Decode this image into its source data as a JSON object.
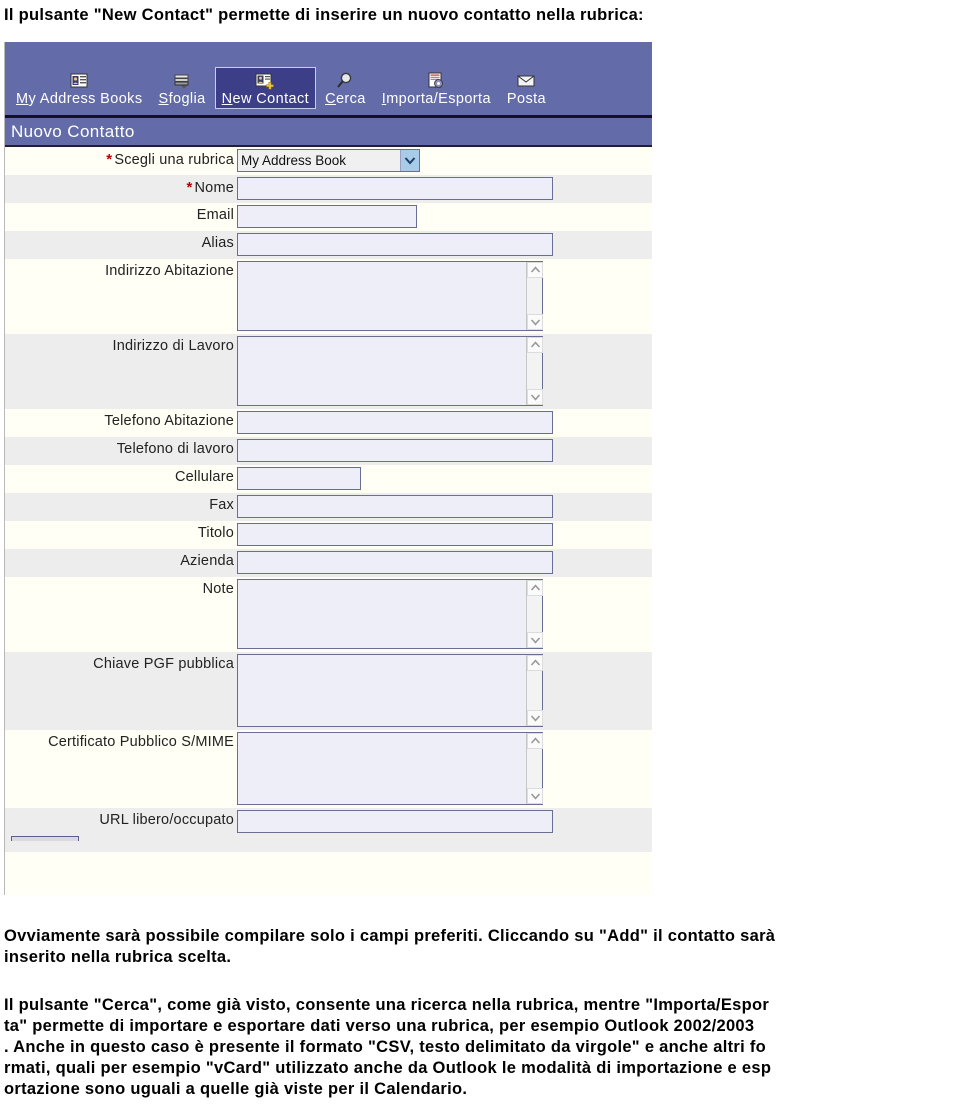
{
  "document": {
    "intro_text": "Il pulsante \"New Contact\" permette di inserire un nuovo contatto nella rubrica:",
    "para_1_line_1": "Ovviamente sarà possibile compilare solo i campi preferiti. Cliccando su \"Add\" il contatto sarà",
    "para_1_line_2": "inserito nella rubrica scelta.",
    "para_2_line_1": "Il pulsante \"Cerca\", come già visto, consente una ricerca nella rubrica, mentre \"Importa/Espor",
    "para_2_line_2": "ta\" permette di importare e esportare dati verso una rubrica, per esempio Outlook 2002/2003",
    "para_2_line_3": ". Anche in questo caso è presente il formato \"CSV, testo delimitato da virgole\" e anche altri fo",
    "para_2_line_4": "rmati, quali per esempio \"vCard\" utilizzato anche da Outlook le modalità di importazione e esp",
    "para_2_line_5": "ortazione sono uguali a quelle già viste per il Calendario."
  },
  "colors": {
    "toolbar_bg": "#636ca8",
    "toolbar_selected_bg": "#3c3f87",
    "form_header_bg": "#636ca8",
    "row_alt_bg": "#ededed",
    "row_bg": "#fffff5",
    "input_bg": "#eeeef8",
    "input_border": "#6b6e93",
    "required_asterisk": "#b00000",
    "select_arrow_bg": "#a8cbe8"
  },
  "toolbar": {
    "items": [
      {
        "label": "My Address Books",
        "accesskey": "M",
        "icon": "address-book-icon",
        "selected": false
      },
      {
        "label": "Sfoglia",
        "accesskey": "S",
        "icon": "browse-books-icon",
        "selected": false
      },
      {
        "label": "New Contact",
        "accesskey": "N",
        "icon": "new-contact-icon",
        "selected": true
      },
      {
        "label": "Cerca",
        "accesskey": "C",
        "icon": "magnifier-icon",
        "selected": false
      },
      {
        "label": "Importa/Esporta",
        "accesskey": "I",
        "icon": "import-export-icon",
        "selected": false
      },
      {
        "label": "Posta",
        "accesskey": "",
        "icon": "envelope-icon",
        "selected": false
      }
    ]
  },
  "form": {
    "title": "Nuovo Contatto",
    "address_book_select": {
      "selected": "My Address Book",
      "options": [
        "My Address Book"
      ]
    },
    "fields": [
      {
        "label": "Scegli una rubrica",
        "required": true,
        "type": "select",
        "value": "My Address Book",
        "alt": false
      },
      {
        "label": "Nome",
        "required": true,
        "type": "text",
        "value": "",
        "width": "long",
        "alt": true
      },
      {
        "label": "Email",
        "required": false,
        "type": "text",
        "value": "",
        "width": "mid",
        "alt": false
      },
      {
        "label": "Alias",
        "required": false,
        "type": "text",
        "value": "",
        "width": "long",
        "alt": true
      },
      {
        "label": "Indirizzo Abitazione",
        "required": false,
        "type": "textarea",
        "value": "",
        "height": "short",
        "alt": false
      },
      {
        "label": "Indirizzo di Lavoro",
        "required": false,
        "type": "textarea",
        "value": "",
        "height": "short",
        "alt": true
      },
      {
        "label": "Telefono Abitazione",
        "required": false,
        "type": "text",
        "value": "",
        "width": "long",
        "alt": false
      },
      {
        "label": "Telefono di lavoro",
        "required": false,
        "type": "text",
        "value": "",
        "width": "long",
        "alt": true
      },
      {
        "label": "Cellulare",
        "required": false,
        "type": "text",
        "value": "",
        "width": "short",
        "alt": false
      },
      {
        "label": "Fax",
        "required": false,
        "type": "text",
        "value": "",
        "width": "long",
        "alt": true
      },
      {
        "label": "Titolo",
        "required": false,
        "type": "text",
        "value": "",
        "width": "long",
        "alt": false
      },
      {
        "label": "Azienda",
        "required": false,
        "type": "text",
        "value": "",
        "width": "long",
        "alt": true
      },
      {
        "label": "Note",
        "required": false,
        "type": "textarea",
        "value": "",
        "height": "short",
        "alt": false
      },
      {
        "label": "Chiave PGF pubblica",
        "required": false,
        "type": "textarea",
        "value": "",
        "height": "tall",
        "alt": true
      },
      {
        "label": "Certificato Pubblico S/MIME",
        "required": false,
        "type": "textarea",
        "value": "",
        "height": "tall",
        "alt": false
      },
      {
        "label": "URL libero/occupato",
        "required": false,
        "type": "text",
        "value": "",
        "width": "long",
        "alt": true
      }
    ]
  }
}
